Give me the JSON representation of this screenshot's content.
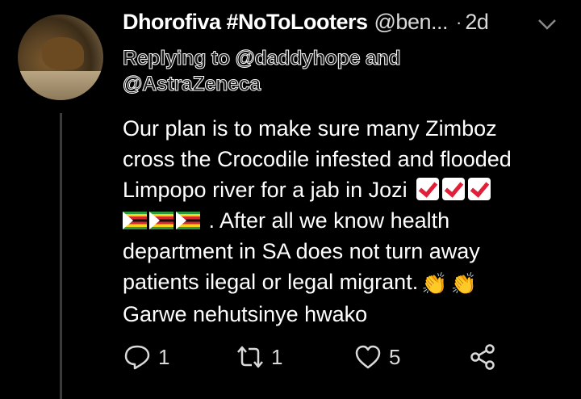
{
  "tweet": {
    "display_name": "Dhorofiva #NoToLooters",
    "handle": "@ben...",
    "separator": "·",
    "time": "2d",
    "replying_to_line1": "Replying to @daddyhope and",
    "replying_to_line2": "@AstraZeneca",
    "body": {
      "line1": "Our plan is to make sure many Zimboz",
      "line2": "cross the Crocodile infested and flooded",
      "line3": "Limpopo river for a jab in Jozi",
      "line4": ". After all we know health",
      "line5": "department in SA does not turn away",
      "line6": "patients ilegal or legal migrant.",
      "line7": "Garwe nehutsinye hwako"
    },
    "emojis": {
      "check": "check-mark-emoji",
      "flag": "zimbabwe-flag-emoji",
      "clap": "clapping-hands-emoji"
    },
    "actions": {
      "reply_count": "1",
      "retweet_count": "1",
      "like_count": "5"
    }
  },
  "colors": {
    "background": "#000000",
    "text": "#ffffff",
    "secondary_text": "#d9d9d9",
    "thread_line": "#3a3a3a"
  }
}
